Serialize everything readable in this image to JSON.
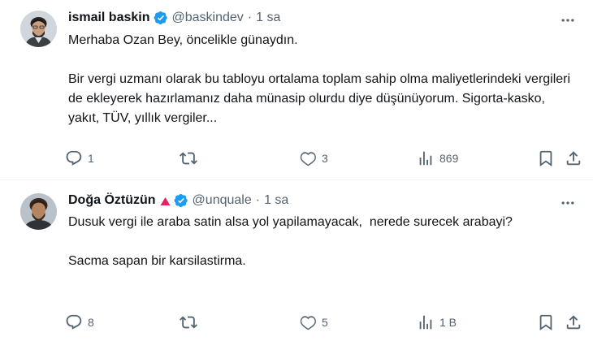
{
  "tweets": [
    {
      "name": "ismail baskin",
      "handle": "@baskindev",
      "separator": "·",
      "time": "1 sa",
      "paragraphs": [
        "Merhaba Ozan Bey, öncelikle günaydın.",
        "Bir vergi uzmanı olarak bu tabloyu ortalama toplam sahip olma maliyetlerindeki vergileri de ekleyerek hazırlamanız daha münasip olurdu diye düşünüyorum. Sigorta-kasko, yakıt, TÜV, yıllık vergiler..."
      ],
      "replies": "1",
      "retweets": "",
      "likes": "3",
      "views": "869"
    },
    {
      "name": "Doğa Öztüzün",
      "handle": "@unquale",
      "separator": "·",
      "time": "1 sa",
      "paragraphs": [
        "Dusuk vergi ile araba satin alsa yol yapilamayacak,  nerede surecek arabayi?",
        "Sacma sapan bir karsilastirma."
      ],
      "replies": "8",
      "retweets": "",
      "likes": "5",
      "views": "1 B"
    }
  ],
  "colors": {
    "verified": "#1d9bf0",
    "muted": "#536471",
    "text": "#0f1419",
    "flag": "#e0245e",
    "divider": "#eff3f4"
  },
  "icons": [
    "more-icon",
    "verified-badge-icon",
    "red-triangle-icon",
    "reply-icon",
    "retweet-icon",
    "like-icon",
    "views-icon",
    "bookmark-icon",
    "share-icon"
  ]
}
